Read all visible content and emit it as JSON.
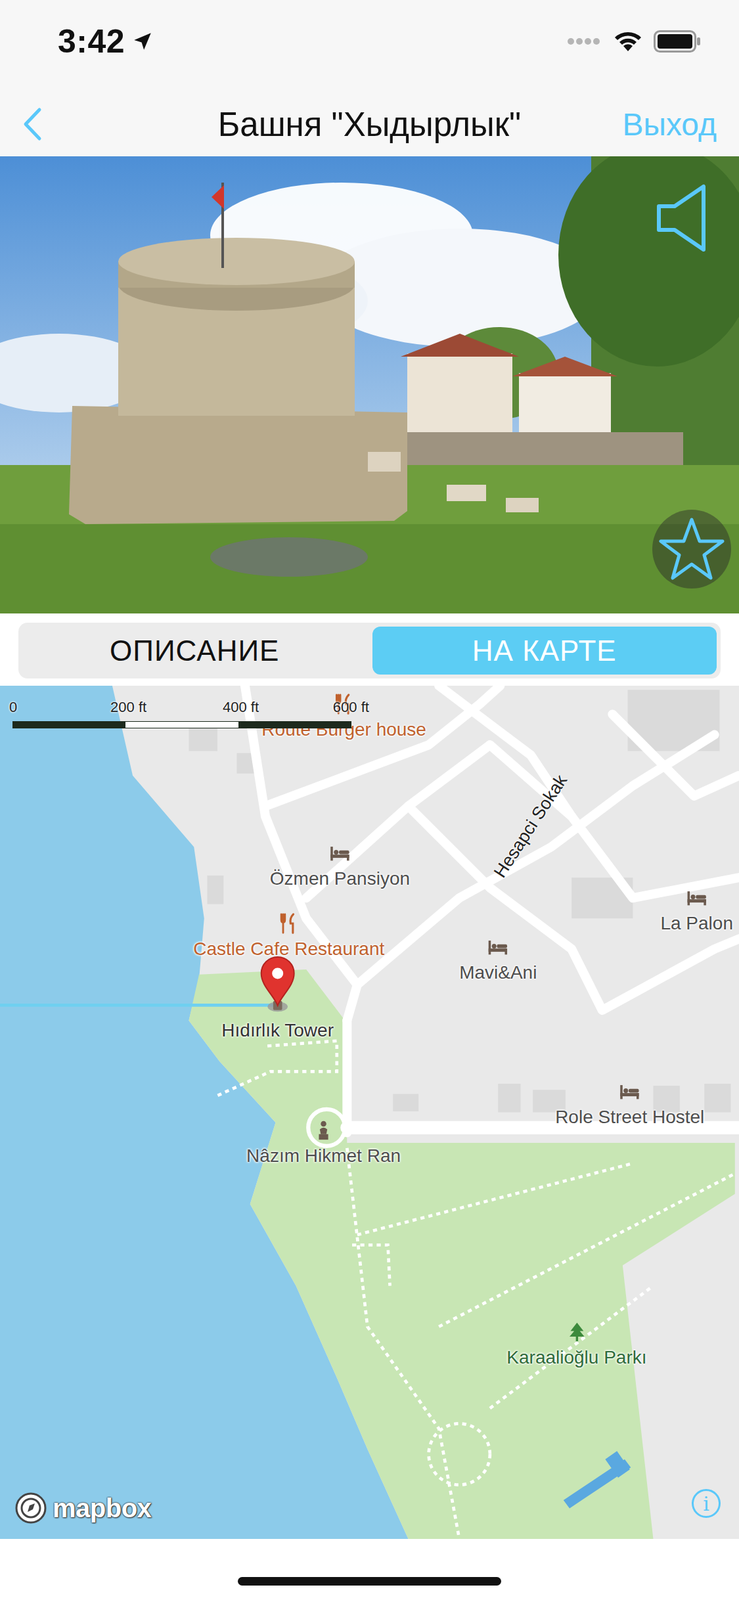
{
  "status_bar": {
    "time": "3:42"
  },
  "nav": {
    "title": "Башня \"Хыдырлык\"",
    "exit": "Выход"
  },
  "photo": {
    "favorite": false
  },
  "segments": [
    {
      "label": "ОПИСАНИЕ",
      "selected": false
    },
    {
      "label": "НА КАРТЕ",
      "selected": true
    }
  ],
  "map": {
    "scale": [
      "0",
      "200 ft",
      "400 ft",
      "600 ft"
    ],
    "streets": [
      {
        "name": "Hesapci Sokak"
      }
    ],
    "places": [
      {
        "name": "Route Burger house",
        "kind": "food",
        "pinned": false
      },
      {
        "name": "Özmen Pansiyon",
        "kind": "lodging",
        "pinned": false
      },
      {
        "name": "Castle Cafe Restaurant",
        "kind": "food",
        "pinned": false
      },
      {
        "name": "Mavi&Ani",
        "kind": "lodging",
        "pinned": false
      },
      {
        "name": "La Palon",
        "kind": "lodging",
        "pinned": false
      },
      {
        "name": "Hıdırlık Tower",
        "kind": "tower",
        "pinned": true
      },
      {
        "name": "Nâzım Hikmet Ran",
        "kind": "monument",
        "pinned": false
      },
      {
        "name": "Role Street Hostel",
        "kind": "lodging",
        "pinned": false
      },
      {
        "name": "Karaalioğlu Parkı",
        "kind": "park",
        "pinned": false
      }
    ],
    "logo": "mapbox",
    "info": "i"
  }
}
